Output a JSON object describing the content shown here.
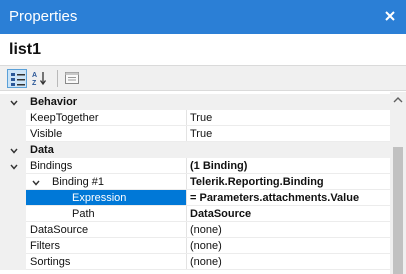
{
  "panel": {
    "title": "Properties",
    "object_name": "list1"
  },
  "toolbar": {
    "categorized_icon": "categorized-view-icon",
    "alphabetical_icon": "alphabetical-sort-icon",
    "property_pages_icon": "property-pages-icon"
  },
  "grid": {
    "categories": {
      "behavior": "Behavior",
      "data": "Data"
    },
    "rows": {
      "keeptogether": {
        "name": "KeepTogether",
        "value": "True"
      },
      "visible": {
        "name": "Visible",
        "value": "True"
      },
      "bindings": {
        "name": "Bindings",
        "value": "(1 Binding)"
      },
      "binding1": {
        "name": "Binding #1",
        "value": "Telerik.Reporting.Binding"
      },
      "expression": {
        "name": "Expression",
        "value": "= Parameters.attachments.Value"
      },
      "path": {
        "name": "Path",
        "value": "DataSource"
      },
      "datasource": {
        "name": "DataSource",
        "value": "(none)"
      },
      "filters": {
        "name": "Filters",
        "value": "(none)"
      },
      "sortings": {
        "name": "Sortings",
        "value": "(none)"
      }
    }
  },
  "colors": {
    "title_bar": "#2b7fd6",
    "selection": "#0078d7",
    "category_bg": "#f0f0f0"
  }
}
